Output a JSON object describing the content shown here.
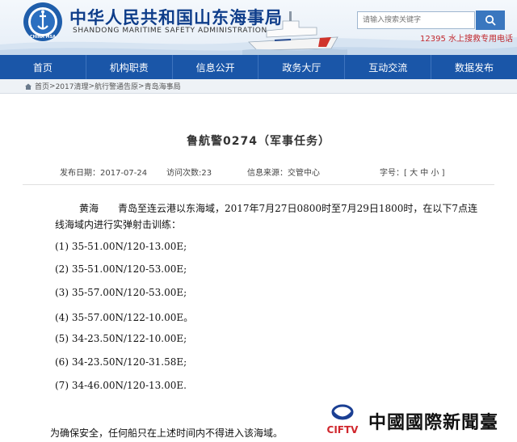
{
  "header": {
    "title": "中华人民共和国山东海事局",
    "subtitle": "SHANDONG MARITIME SAFETY ADMINISTRATION",
    "logo_text": "CHINA MSA",
    "search_placeholder": "请输入搜索关键字",
    "hotline": "12395 水上搜救专用电话"
  },
  "nav": {
    "items": [
      "首页",
      "机构职责",
      "信息公开",
      "政务大厅",
      "互动交流",
      "数据发布"
    ]
  },
  "breadcrumb": {
    "items": [
      "首页",
      "2017清理",
      "航行警通告原",
      "青岛海事局"
    ],
    "separator": ">"
  },
  "article": {
    "title": "鲁航警0274（军事任务）",
    "meta": {
      "date": "发布日期：2017-07-24",
      "views": "访问次数:23",
      "source": "信息来源：交管中心",
      "font_size_label": "字号：[",
      "size_large": "大",
      "size_medium": "中",
      "size_small": "小",
      "font_size_close": "]"
    },
    "para_line1": "黄海　　青岛至连云港以东海域，2017年7月27日0800时至7月29日1800时，在以下7点连",
    "para_line2": "线海域内进行实弹射击训练：",
    "coordinates": [
      "(1)  35-51.00N/120-13.00E;",
      "(2)  35-51.00N/120-53.00E;",
      "(3)  35-57.00N/120-53.00E;",
      "(4)  35-57.00N/122-10.00E。",
      "(5)  34-23.50N/122-10.00E;",
      "(6)  34-23.50N/120-31.58E;",
      "(7)  34-46.00N/120-13.00E."
    ],
    "closing": "为确保安全，任何船只在上述时间内不得进入该海域。"
  },
  "watermark": {
    "logo_text": "CIFTV",
    "text": "中國國際新聞臺"
  },
  "colors": {
    "nav": "#1a56a8",
    "title_blue": "#0e3d8a",
    "hotline_red": "#c0272d"
  }
}
